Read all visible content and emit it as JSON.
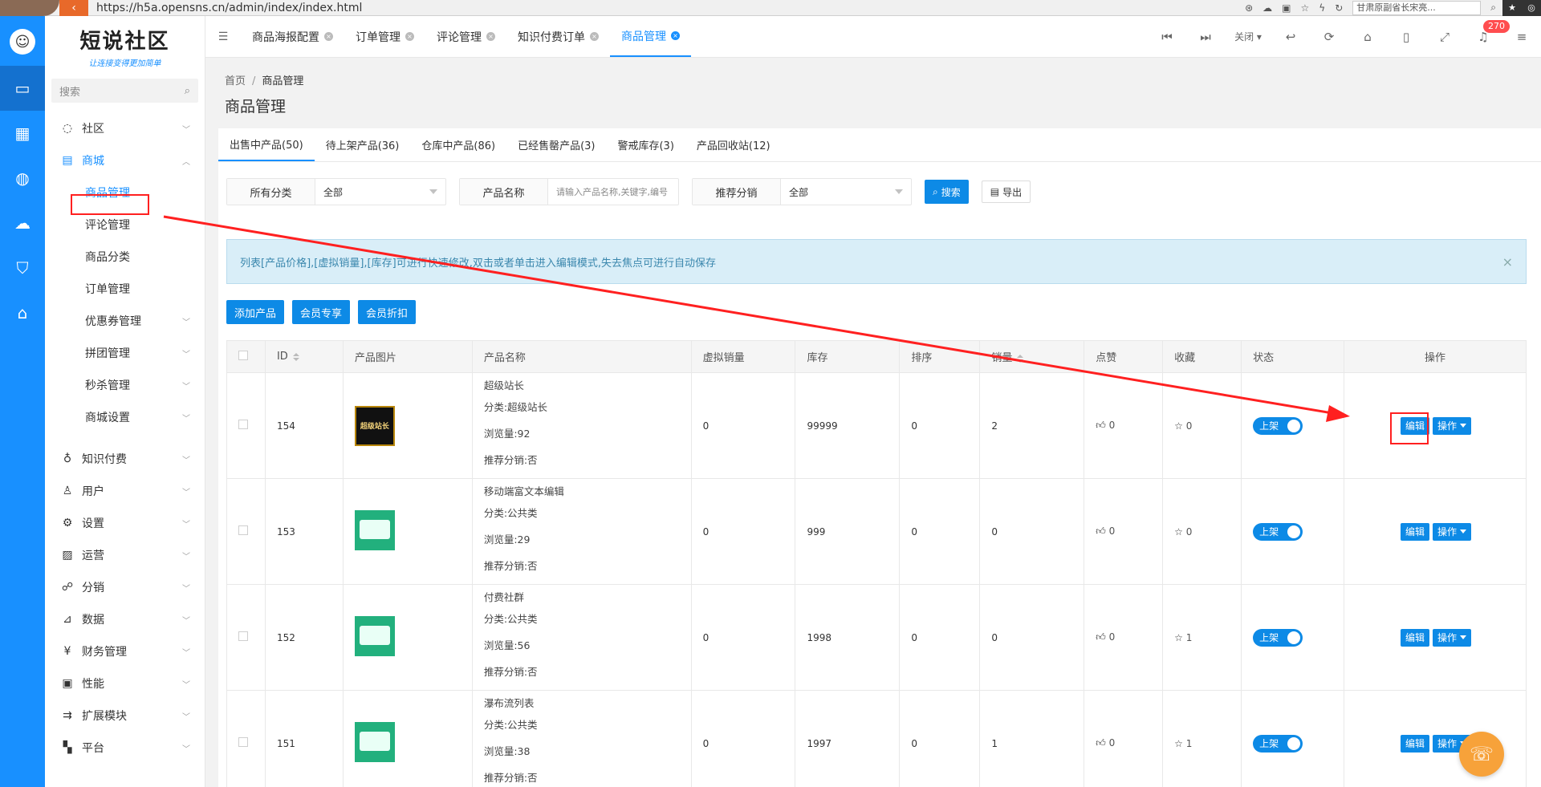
{
  "browser": {
    "url": "https://h5a.opensns.cn/admin/index/index.html",
    "search_placeholder": "甘肃原副省长宋亮..."
  },
  "rail": {
    "items": [
      "monitor-icon",
      "grid-icon",
      "globe-icon",
      "cloud-icon",
      "shield-icon",
      "router-icon"
    ]
  },
  "logo": {
    "title": "短说社区",
    "slogan": "让连接变得更加简单"
  },
  "menu": {
    "search_placeholder": "搜索",
    "items": [
      {
        "label": "社区",
        "icon": "chat-icon"
      },
      {
        "label": "商城",
        "icon": "shop-icon"
      },
      {
        "label": "知识付费",
        "icon": "bulb-icon"
      },
      {
        "label": "用户",
        "icon": "user-icon"
      },
      {
        "label": "设置",
        "icon": "gear-icon"
      },
      {
        "label": "运营",
        "icon": "chart-icon"
      },
      {
        "label": "分销",
        "icon": "network-icon"
      },
      {
        "label": "数据",
        "icon": "line-chart-icon"
      },
      {
        "label": "财务管理",
        "icon": "yen-icon"
      },
      {
        "label": "性能",
        "icon": "calendar-icon"
      },
      {
        "label": "扩展模块",
        "icon": "extension-icon"
      },
      {
        "label": "平台",
        "icon": "platform-icon"
      }
    ],
    "shop_sub": [
      "商品管理",
      "评论管理",
      "商品分类",
      "订单管理",
      "优惠券管理",
      "拼团管理",
      "秒杀管理",
      "商城设置"
    ]
  },
  "topbar": {
    "tabs": [
      "商品海报配置",
      "订单管理",
      "评论管理",
      "知识付费订单",
      "商品管理"
    ],
    "close_label": "关闭",
    "badge_count": "270"
  },
  "breadcrumb": {
    "home": "首页",
    "sep": "/",
    "current": "商品管理"
  },
  "page_title": "商品管理",
  "product_tabs": [
    "出售中产品(50)",
    "待上架产品(36)",
    "仓库中产品(86)",
    "已经售罄产品(3)",
    "警戒库存(3)",
    "产品回收站(12)"
  ],
  "filters": {
    "category_label": "所有分类",
    "category_value": "全部",
    "name_label": "产品名称",
    "name_placeholder": "请输入产品名称,关键字,编号",
    "dist_label": "推荐分销",
    "dist_value": "全部",
    "search_btn": "搜索",
    "export_btn": "导出"
  },
  "notice": {
    "text": "列表[产品价格],[虚拟销量],[库存]可进行快速修改,双击或者单击进入编辑模式,失去焦点可进行自动保存",
    "close": "×"
  },
  "action_buttons": [
    "添加产品",
    "会员专享",
    "会员折扣"
  ],
  "table": {
    "headers": [
      "ID",
      "产品图片",
      "产品名称",
      "虚拟销量",
      "库存",
      "排序",
      "销量",
      "点赞",
      "收藏",
      "状态",
      "操作"
    ],
    "rows": [
      {
        "id": "154",
        "thumb_text": "超级站长",
        "name": "超级站长",
        "cat": "分类:超级站长",
        "views": "浏览量:92",
        "dist": "推荐分销:否",
        "virtual": "0",
        "stock": "99999",
        "sort": "0",
        "sales": "2",
        "likes": "0",
        "favs": "0",
        "status": "上架"
      },
      {
        "id": "153",
        "thumb_text": "",
        "name": "移动端富文本编辑",
        "cat": "分类:公共类",
        "views": "浏览量:29",
        "dist": "推荐分销:否",
        "virtual": "0",
        "stock": "999",
        "sort": "0",
        "sales": "0",
        "likes": "0",
        "favs": "0",
        "status": "上架"
      },
      {
        "id": "152",
        "thumb_text": "",
        "name": "付费社群",
        "cat": "分类:公共类",
        "views": "浏览量:56",
        "dist": "推荐分销:否",
        "virtual": "0",
        "stock": "1998",
        "sort": "0",
        "sales": "0",
        "likes": "0",
        "favs": "1",
        "status": "上架"
      },
      {
        "id": "151",
        "thumb_text": "",
        "name": "瀑布流列表",
        "cat": "分类:公共类",
        "views": "浏览量:38",
        "dist": "推荐分销:否",
        "virtual": "0",
        "stock": "1997",
        "sort": "0",
        "sales": "1",
        "likes": "0",
        "favs": "1",
        "status": "上架"
      }
    ],
    "edit_label": "编辑",
    "op_label": "操作"
  },
  "colors": {
    "accent": "#0d8ae6",
    "annotation": "#ff2020",
    "rail": "#1890ff"
  }
}
